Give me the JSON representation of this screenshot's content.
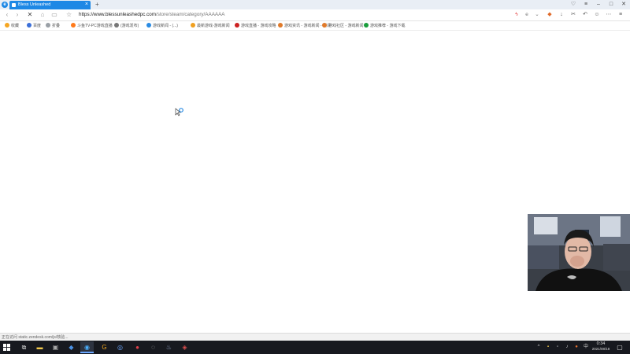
{
  "browser": {
    "tab_title": "Bless Unleashed",
    "new_tab_glyph": "+",
    "url_host": "https://www.blessunleashedpc.com",
    "url_path": "/store/steam/category/AAAAAA"
  },
  "bookmarks": [
    {
      "label": "收藏",
      "color": "#f5a623",
      "icon": "star-icon"
    },
    {
      "label": "百度",
      "color": "#3b6fd8",
      "icon": "baidu-icon"
    },
    {
      "label": "折叠",
      "color": "#9aa0a6",
      "icon": "folder-icon"
    },
    {
      "label": "斗鱼TV-PC游戏直播",
      "color": "#ff7a1a",
      "icon": "douyu-icon"
    },
    {
      "label": "(游戏发布)",
      "color": "#777777",
      "icon": "globe-icon"
    },
    {
      "label": "游戏新闻 - (...)",
      "color": "#2a8be3",
      "icon": "news-icon"
    },
    {
      "label": "最新游戏-游戏新闻",
      "color": "#f0a020",
      "icon": "gamepad-icon"
    },
    {
      "label": "游戏直播 - 游戏攻略",
      "color": "#cc2222",
      "icon": "live-icon"
    },
    {
      "label": "游戏资讯 - 游戏新闻 - 测评",
      "color": "#e07a2a",
      "icon": "pin-icon"
    },
    {
      "label": "游戏社区 - 游戏新闻",
      "color": "#e07a2a",
      "icon": "pin-icon"
    },
    {
      "label": "游戏推荐 - 游戏下载",
      "color": "#1a9d3c",
      "icon": "grid-icon"
    }
  ],
  "status": {
    "text": "正在访问 static.zendesk.com/js/核验..."
  },
  "taskbar": {
    "time": "0:34",
    "date": "2021/08/18"
  },
  "webcam": {
    "label": "streamer-webcam"
  }
}
